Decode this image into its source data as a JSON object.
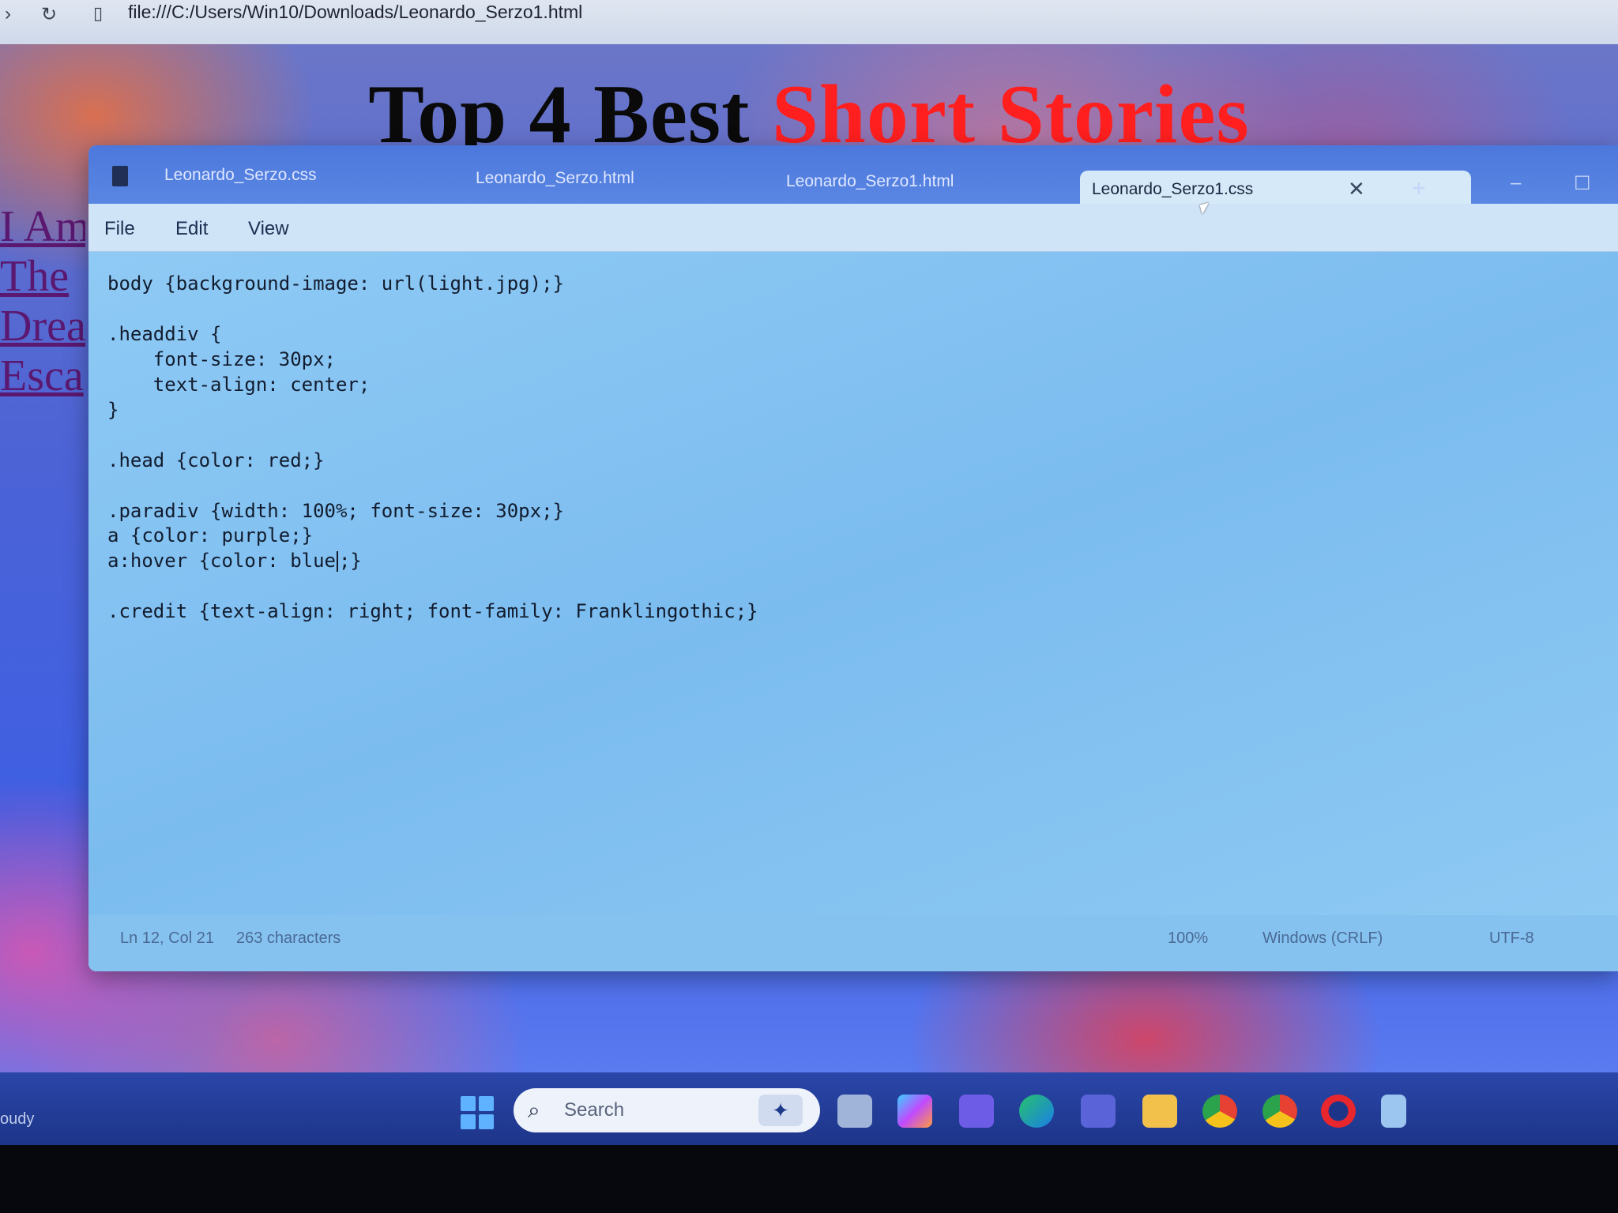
{
  "browser": {
    "address": "file:///C:/Users/Win10/Downloads/Leonardo_Serzo1.html"
  },
  "webpage": {
    "title_black": "Top 4 Best",
    "title_red": "Short Stories",
    "links": [
      "I Am",
      "The",
      "Drea",
      "Esca"
    ]
  },
  "notepad": {
    "tabs": [
      {
        "label": "Leonardo_Serzo.css"
      },
      {
        "label": "Leonardo_Serzo.html"
      },
      {
        "label": "Leonardo_Serzo1.html"
      },
      {
        "label": "Leonardo_Serzo1.css",
        "active": true
      }
    ],
    "menu": [
      "File",
      "Edit",
      "View"
    ],
    "code_lines": [
      "body {background-image: url(light.jpg);}",
      "",
      ".headdiv {",
      "    font-size: 30px;",
      "    text-align: center;",
      "}",
      "",
      ".head {color: red;}",
      "",
      ".paradiv {width: 100%; font-size: 30px;}",
      "a {color: purple;}",
      "a:hover {color: blue",
      ";}",
      "",
      ".credit {text-align: right; font-family: Franklingothic;}"
    ],
    "status": {
      "position": "Ln 12, Col 21",
      "characters": "263 characters",
      "zoom": "100%",
      "line_endings": "Windows (CRLF)",
      "encoding": "UTF-8"
    }
  },
  "taskbar": {
    "weather": "oudy",
    "search_placeholder": "Search",
    "apps": [
      "task-view",
      "copilot",
      "teams",
      "edge",
      "teams-work",
      "file-explorer",
      "chrome",
      "chrome-profile",
      "opera",
      "notepad"
    ]
  },
  "colors": {
    "title_red": "#ff1f1f",
    "link_purple": "#5b1870",
    "notepad_bg": "#7fbff0"
  }
}
